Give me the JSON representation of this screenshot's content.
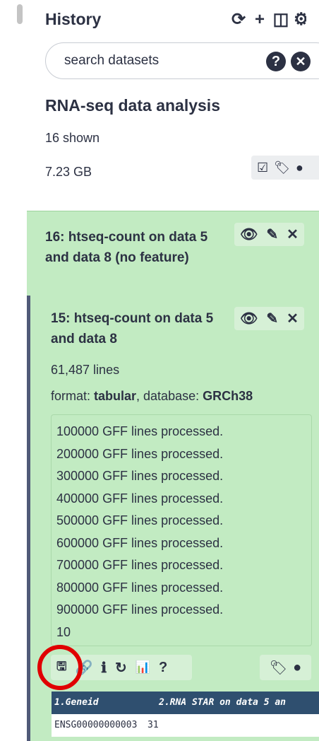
{
  "header": {
    "title": "History",
    "icons": [
      "refresh-icon",
      "plus-icon",
      "columns-icon",
      "gear-icon"
    ]
  },
  "search": {
    "placeholder": "search datasets",
    "help_glyph": "?",
    "clear_glyph": "✕"
  },
  "history": {
    "name": "RNA-seq data analysis",
    "shown": "16 shown",
    "size": "7.23 GB"
  },
  "datasets": [
    {
      "title": "16: htseq-count on data 5 and data 8 (no feature)"
    },
    {
      "title": "15: htseq-count on data 5 and data 8",
      "lines": "61,487 lines",
      "format_label": "format: ",
      "format_value": "tabular",
      "database_label": ", database: ",
      "database_value": "GRCh38",
      "peek": [
        "100000 GFF lines processed.",
        "200000 GFF lines processed.",
        "300000 GFF lines processed.",
        "400000 GFF lines processed.",
        "500000 GFF lines processed.",
        "600000 GFF lines processed.",
        "700000 GFF lines processed.",
        "800000 GFF lines processed.",
        "900000 GFF lines processed.",
        "10"
      ],
      "table": {
        "columns": [
          "1.Geneid",
          "2.RNA STAR on data 5 an"
        ],
        "rows": [
          [
            "ENSG00000000003",
            "31"
          ]
        ]
      }
    }
  ],
  "colors": {
    "ok_state": "#c2ebc2",
    "highlight": "#e00000",
    "table_header": "#2f4f6f"
  }
}
